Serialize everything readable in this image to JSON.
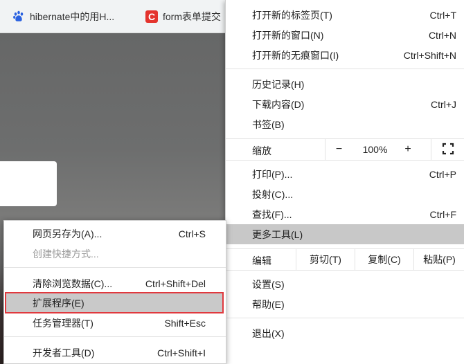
{
  "bookmarks": [
    {
      "icon": "baidu-paw-icon",
      "label": "hibernate中的用H..."
    },
    {
      "icon": "csdn-icon",
      "icon_text": "C",
      "label": "form表单提交"
    }
  ],
  "main_menu": {
    "new_tab": {
      "label": "打开新的标签页(T)",
      "shortcut": "Ctrl+T"
    },
    "new_window": {
      "label": "打开新的窗口(N)",
      "shortcut": "Ctrl+N"
    },
    "new_incognito": {
      "label": "打开新的无痕窗口(I)",
      "shortcut": "Ctrl+Shift+N"
    },
    "history": {
      "label": "历史记录(H)"
    },
    "downloads": {
      "label": "下载内容(D)",
      "shortcut": "Ctrl+J"
    },
    "bookmarks": {
      "label": "书签(B)"
    },
    "zoom": {
      "label": "缩放",
      "minus": "−",
      "value": "100%",
      "plus": "+"
    },
    "print": {
      "label": "打印(P)...",
      "shortcut": "Ctrl+P"
    },
    "cast": {
      "label": "投射(C)..."
    },
    "find": {
      "label": "查找(F)...",
      "shortcut": "Ctrl+F"
    },
    "more_tools": {
      "label": "更多工具(L)"
    },
    "edit": {
      "label": "编辑",
      "cut": "剪切(T)",
      "copy": "复制(C)",
      "paste": "粘贴(P)"
    },
    "settings": {
      "label": "设置(S)"
    },
    "help": {
      "label": "帮助(E)"
    },
    "exit": {
      "label": "退出(X)"
    }
  },
  "sub_menu": {
    "save_page": {
      "label": "网页另存为(A)...",
      "shortcut": "Ctrl+S"
    },
    "create_shortcut": {
      "label": "创建快捷方式..."
    },
    "clear_data": {
      "label": "清除浏览数据(C)...",
      "shortcut": "Ctrl+Shift+Del"
    },
    "extensions": {
      "label": "扩展程序(E)"
    },
    "task_manager": {
      "label": "任务管理器(T)",
      "shortcut": "Shift+Esc"
    },
    "dev_tools": {
      "label": "开发者工具(D)",
      "shortcut": "Ctrl+Shift+I"
    }
  },
  "colors": {
    "highlight": "#c8c8c8",
    "selection_border": "#e0393e",
    "csdn_red": "#e4332d",
    "baidu_blue": "#2b62e0"
  }
}
